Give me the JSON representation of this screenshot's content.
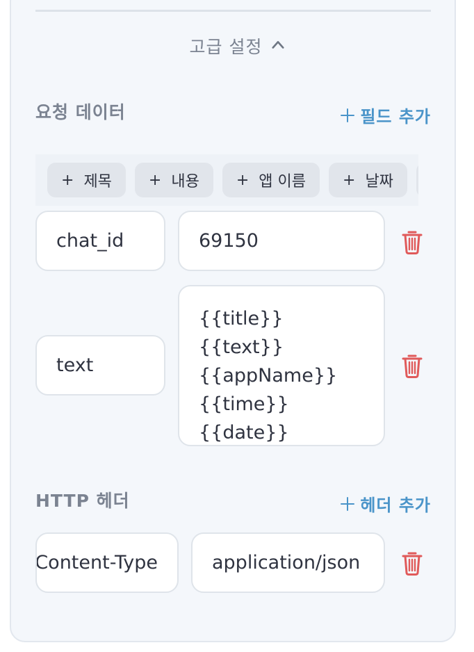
{
  "advanced": {
    "label": "고급 설정"
  },
  "request_data": {
    "title": "요청 데이터",
    "add_field_label": "필드 추가",
    "chips": [
      {
        "label": "제목"
      },
      {
        "label": "내용"
      },
      {
        "label": "앱 이름"
      },
      {
        "label": "날짜"
      },
      {
        "label": ""
      }
    ],
    "rows": [
      {
        "key": "chat_id",
        "value": "69150"
      },
      {
        "key": "text",
        "value": "{{title}}\n{{text}}\n{{appName}}\n{{time}}\n{{date}}"
      }
    ]
  },
  "http_headers": {
    "title": "HTTP 헤더",
    "add_header_label": "헤더 추가",
    "rows": [
      {
        "key": "Content-Type",
        "value": "application/json"
      }
    ]
  },
  "colors": {
    "accent": "#4a94c9",
    "danger": "#e05a5a",
    "muted": "#7b8391",
    "card_bg": "#f4f7fb"
  }
}
